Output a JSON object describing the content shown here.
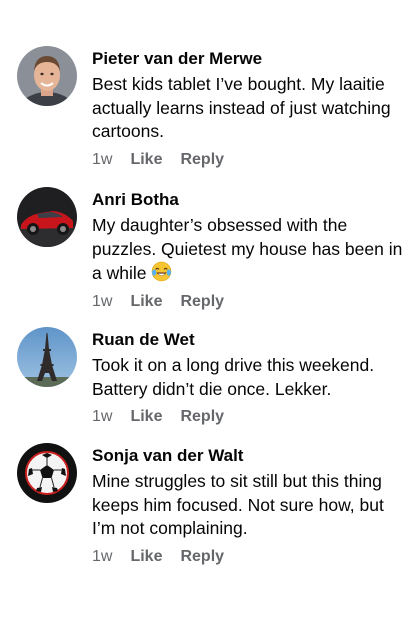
{
  "comments": [
    {
      "author": "Pieter van der Merwe",
      "text": "Best kids tablet I’ve bought. My laaitie actually learns instead of just watching cartoons.",
      "time": "1w",
      "like": "Like",
      "reply": "Reply",
      "avatar": "man-portrait-avatar"
    },
    {
      "author": "Anri Botha",
      "text": "My daughter’s obsessed with the puzzles. Quietest my house has been in a while",
      "emoji": "laughing-tears-emoji",
      "time": "1w",
      "like": "Like",
      "reply": "Reply",
      "avatar": "red-sports-car-avatar"
    },
    {
      "author": "Ruan de Wet",
      "text": "Took it on a long drive this weekend. Battery didn’t die once. Lekker.",
      "time": "1w",
      "like": "Like",
      "reply": "Reply",
      "avatar": "eiffel-tower-avatar"
    },
    {
      "author": "Sonja van der Walt",
      "text": "Mine struggles to sit still but this thing keeps him focused. Not sure how, but I’m not complaining.",
      "time": "1w",
      "like": "Like",
      "reply": "Reply",
      "avatar": "soccer-ball-avatar"
    }
  ]
}
